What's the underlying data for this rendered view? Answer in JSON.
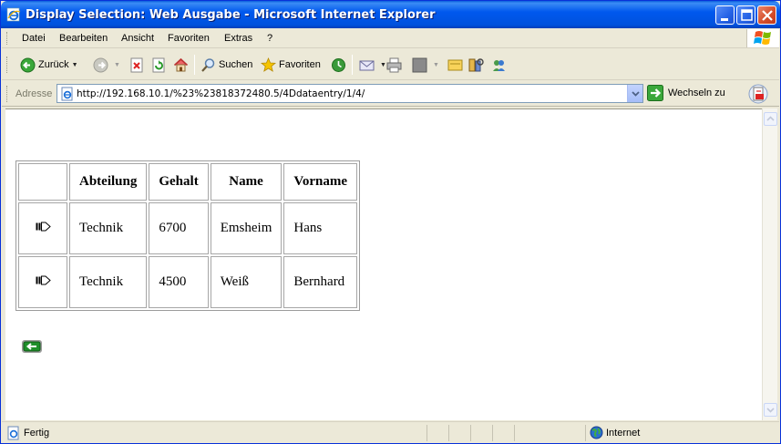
{
  "window": {
    "title": "Display Selection: Web Ausgabe - Microsoft Internet Explorer"
  },
  "menu": [
    "Datei",
    "Bearbeiten",
    "Ansicht",
    "Favoriten",
    "Extras",
    "?"
  ],
  "toolbar": {
    "back": "Zurück",
    "search": "Suchen",
    "favorites": "Favoriten"
  },
  "address": {
    "label": "Adresse",
    "url": "http://192.168.10.1/%23%23818372480.5/4Ddataentry/1/4/",
    "go": "Wechseln zu"
  },
  "table": {
    "headers": [
      "Abteilung",
      "Gehalt",
      "Name",
      "Vorname"
    ],
    "rows": [
      [
        "Technik",
        "6700",
        "Emsheim",
        "Hans"
      ],
      [
        "Technik",
        "4500",
        "Weiß",
        "Bernhard"
      ]
    ]
  },
  "status": {
    "text": "Fertig",
    "zone": "Internet"
  },
  "icons": {
    "row_action": "detail-arrow-icon",
    "back": "back-arrow-icon",
    "title": "ie-icon",
    "status": "page-icon",
    "zone": "globe-icon"
  }
}
